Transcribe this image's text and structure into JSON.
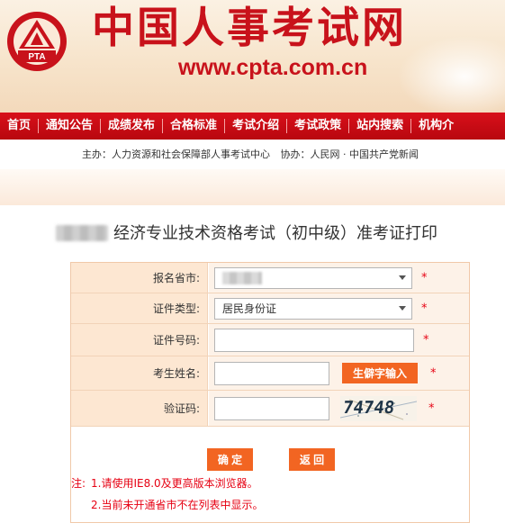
{
  "site": {
    "logo_text": "PTA",
    "title": "中国人事考试网",
    "url": "www.cpta.com.cn"
  },
  "nav": {
    "items": [
      {
        "label": "首页"
      },
      {
        "label": "通知公告"
      },
      {
        "label": "成绩发布"
      },
      {
        "label": "合格标准"
      },
      {
        "label": "考试介绍"
      },
      {
        "label": "考试政策"
      },
      {
        "label": "站内搜索"
      },
      {
        "label": "机构介"
      }
    ]
  },
  "sponsor": {
    "host_label": "主办：",
    "host_value": "人力资源和社会保障部人事考试中心",
    "co_label": "协办：",
    "co_value": "人民网 · 中国共产党新闻"
  },
  "page": {
    "heading": "经济专业技术资格考试（初中级）准考证打印"
  },
  "form": {
    "province_label": "报名省市:",
    "id_type_label": "证件类型:",
    "id_type_value": "居民身份证",
    "id_number_label": "证件号码:",
    "id_number_value": "",
    "name_label": "考生姓名:",
    "name_value": "",
    "rare_char_button": "生僻字输入",
    "captcha_label": "验证码:",
    "captcha_value": "",
    "captcha_image_text": "74748",
    "required_mark": "*",
    "confirm_button": "确 定",
    "back_button": "返 回"
  },
  "notes": {
    "prefix": "注:",
    "line1": "1.请使用IE8.0及更高版本浏览器。",
    "line2": "2.当前未开通省市不在列表中显示。"
  },
  "colors": {
    "brand_red": "#c8121b",
    "nav_red": "#d8101a",
    "button_orange": "#f26522",
    "required_red": "#e60012"
  }
}
